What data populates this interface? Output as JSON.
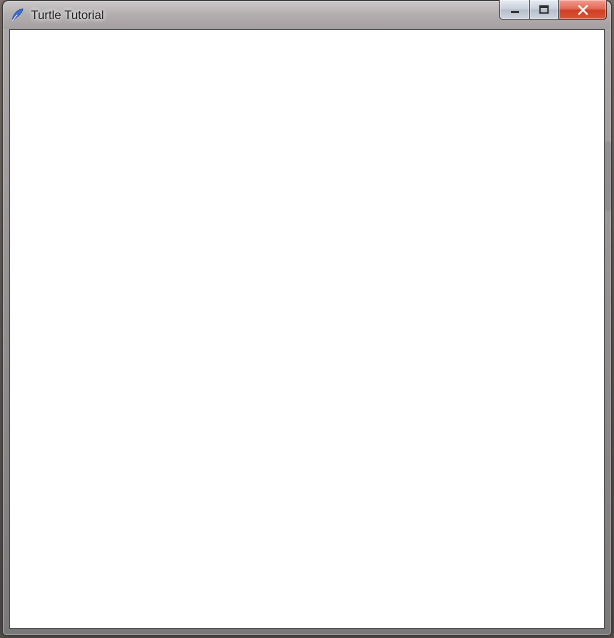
{
  "window": {
    "title": "Turtle Tutorial",
    "icon": "tk-feather-icon"
  },
  "controls": {
    "minimize": {
      "name": "minimize-button",
      "tooltip": "Minimize"
    },
    "maximize": {
      "name": "maximize-button",
      "tooltip": "Maximize"
    },
    "close": {
      "name": "close-button",
      "tooltip": "Close"
    }
  },
  "canvas": {
    "background": "#ffffff"
  }
}
